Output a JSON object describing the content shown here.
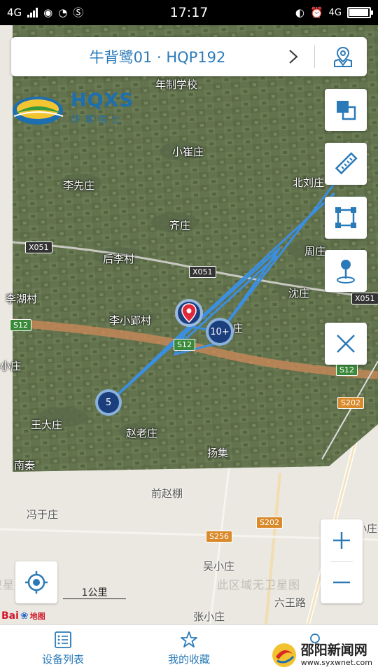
{
  "status_bar": {
    "network": "4G",
    "network_right": "4G",
    "time": "17:17",
    "battery_level": 0.97
  },
  "header": {
    "title": "牛背鹭01 · HQP192"
  },
  "logo": {
    "brand": "HQXS",
    "subtitle": "环球信士"
  },
  "map": {
    "places": {
      "p1": "年制学校",
      "p2": "小崔庄",
      "p3": "李先庄",
      "p4": "北刘庄",
      "p5": "齐庄",
      "p6": "后李村",
      "p7": "周庄",
      "p8": "沈庄",
      "p9": "李湖村",
      "p10": "李小郢村",
      "p11": "庄",
      "p12": "小庄",
      "p13": "王大庄",
      "p14": "赵老庄",
      "p15": "扬集",
      "p16": "南秦",
      "p17": "前赵棚",
      "p18": "冯于庄",
      "p19": "吴小庄",
      "p20": "六王路",
      "p21": "张小庄",
      "p22": "于小庄"
    },
    "roads": {
      "r1": "X051",
      "r2": "X051",
      "r3": "X051",
      "r4": "S12",
      "r5": "S12",
      "r6": "S12",
      "r7": "S202",
      "r8": "S202",
      "r9": "S256"
    },
    "no_satellite": "此区域无卫星图",
    "no_satellite_2": "此区域无卫星图",
    "no_satellite_left": "无卫星图",
    "clusters": {
      "c1": "10+",
      "c2": "5"
    },
    "scale_label": "1公里",
    "baidu_label": "Bai",
    "baidu_label_2": "地图"
  },
  "bottom_nav": {
    "device_list": "设备列表",
    "favorites": "我的收藏"
  },
  "watermark": {
    "title": "邵阳新闻网",
    "url": "www.syxwnet.com"
  },
  "colors": {
    "accent": "#2a7ab8",
    "track": "#3b8fe0",
    "marker_red": "#e0283a",
    "cluster_fill": "#1b3e7d"
  }
}
